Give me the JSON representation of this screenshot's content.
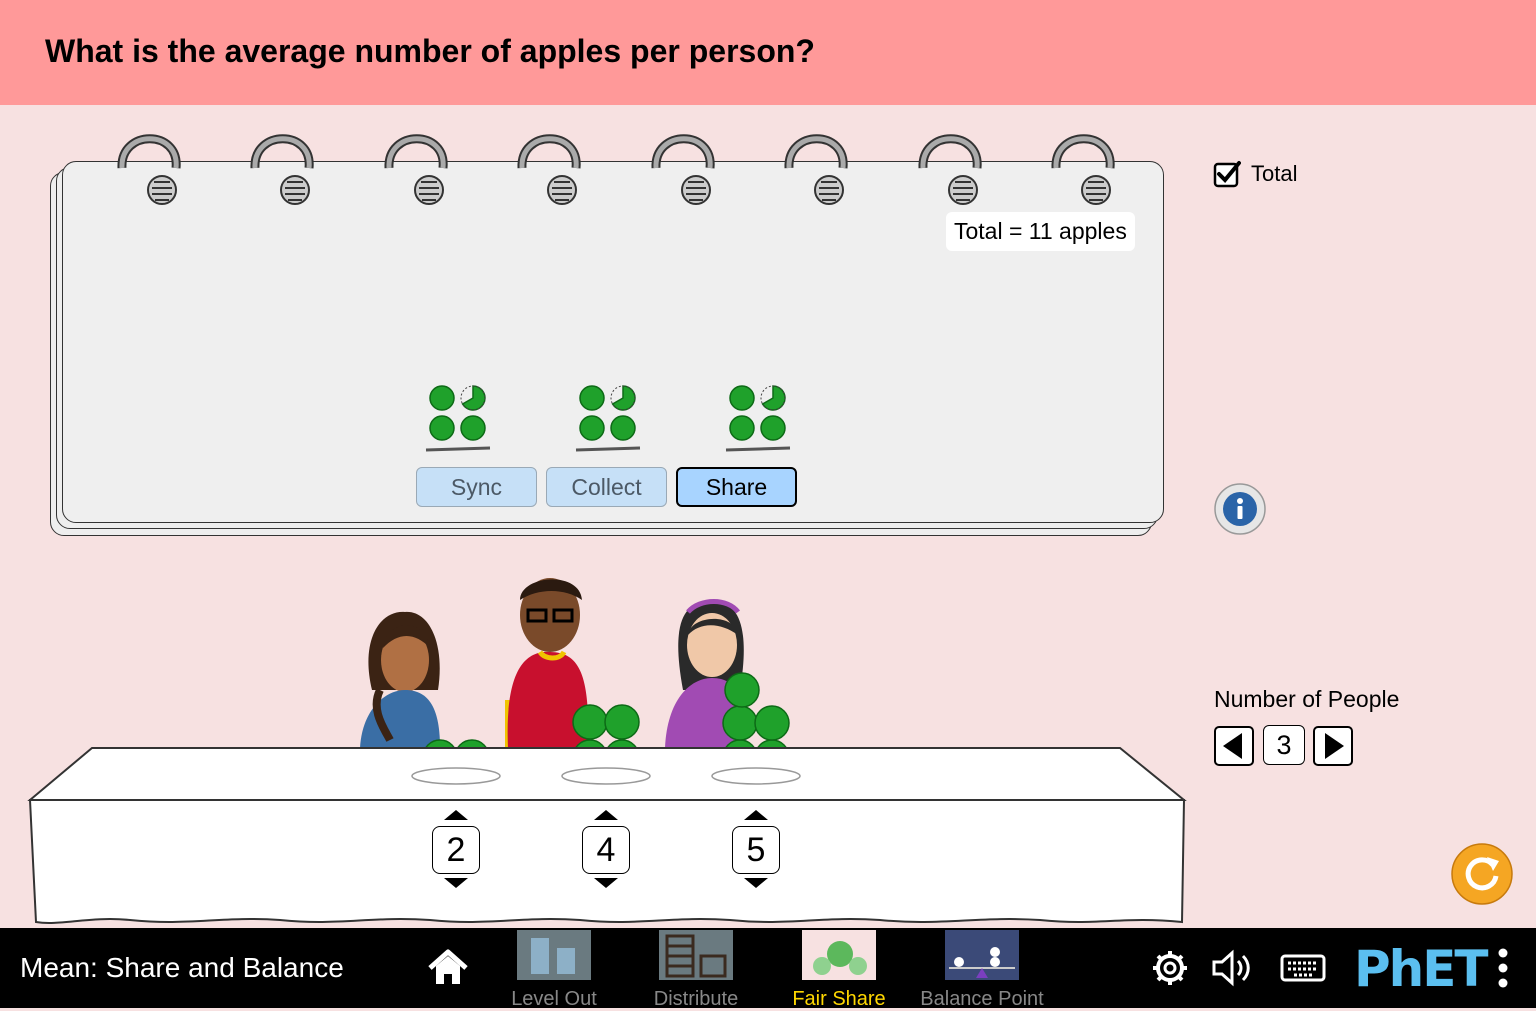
{
  "question": "What is the average number of apples per person?",
  "notebook": {
    "total_label": "Total = 11 apples",
    "buttons": {
      "sync": "Sync",
      "collect": "Collect",
      "share": "Share"
    },
    "active_button": "Share"
  },
  "controls": {
    "total_checkbox_label": "Total",
    "total_checked": true,
    "number_of_people_label": "Number of People",
    "number_of_people": "3"
  },
  "people": [
    {
      "apples": "2"
    },
    {
      "apples": "4"
    },
    {
      "apples": "5"
    }
  ],
  "navbar": {
    "sim_title": "Mean: Share and Balance",
    "tabs": [
      "Level Out",
      "Distribute",
      "Fair Share",
      "Balance Point"
    ],
    "active_tab": "Fair Share",
    "logo": "PhET"
  },
  "colors": {
    "banner": "#ff9999",
    "background": "#f7e1e1",
    "apple": "#1fa12b",
    "active_tab": "#ffd700"
  }
}
